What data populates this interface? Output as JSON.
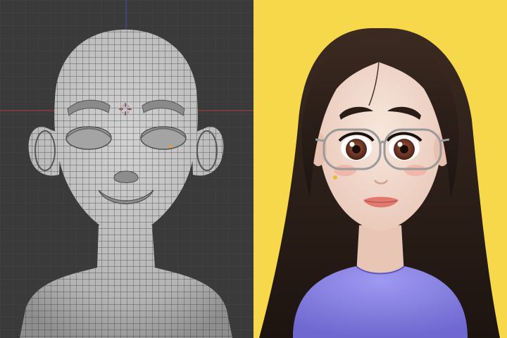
{
  "left_panel": {
    "subject": "wireframe-mesh-head",
    "background_color": "#3a3a3a",
    "grid_color": "#444444",
    "mesh_fill": "#b8b8b8",
    "wire_color": "#3c3c3c",
    "axis_x_color": "#b03a3a",
    "axis_y_color": "#4a4ab0",
    "cursor_icon": "3d-cursor-icon"
  },
  "right_panel": {
    "subject": "rendered-cartoon-girl",
    "background_color": "#f7d84a",
    "skin_color": "#f4ddd2",
    "hair_color": "#2a1d17",
    "shirt_color": "#8c86e6",
    "glasses_color": "#9a9a9a",
    "lips_color": "#e07a70",
    "iris_color": "#6b3322"
  }
}
